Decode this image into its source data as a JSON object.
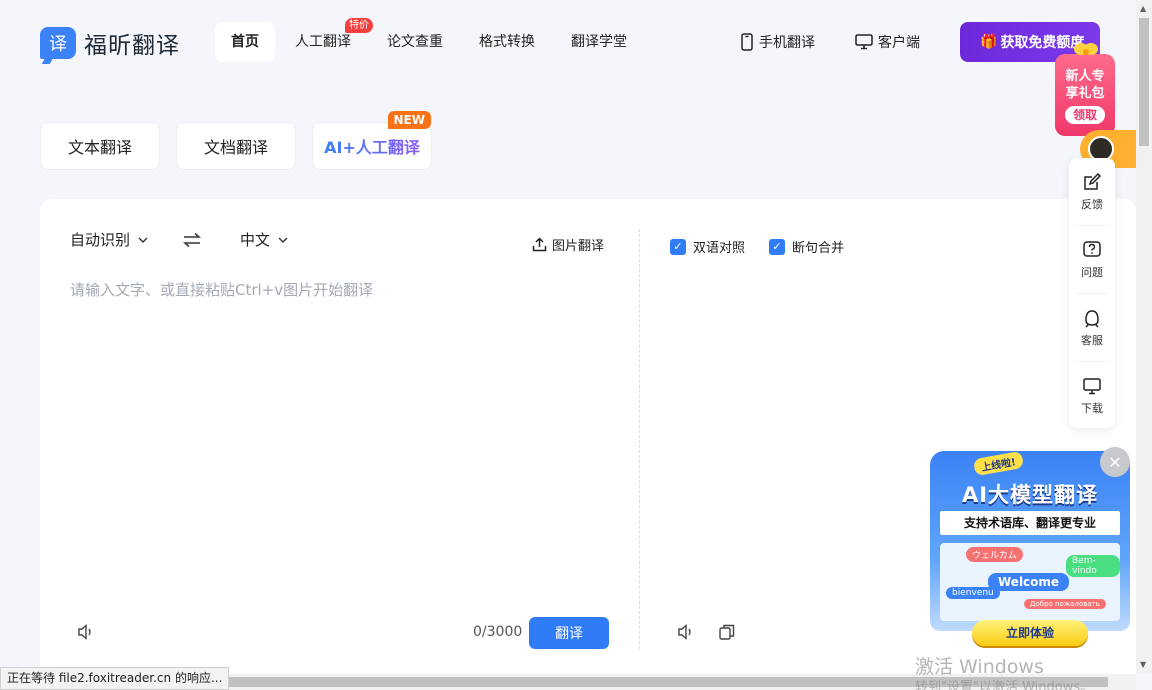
{
  "brand": {
    "logo_char": "译",
    "name": "福昕翻译"
  },
  "nav": [
    {
      "label": "首页",
      "active": true
    },
    {
      "label": "人工翻译",
      "badge": "特价"
    },
    {
      "label": "论文查重"
    },
    {
      "label": "格式转换"
    },
    {
      "label": "翻译学堂"
    }
  ],
  "top_right": {
    "mobile": "手机翻译",
    "desktop": "客户端",
    "cta": "获取免费额度"
  },
  "modes": [
    {
      "label": "文本翻译"
    },
    {
      "label": "文档翻译"
    },
    {
      "label": "AI+人工翻译",
      "badge": "NEW"
    }
  ],
  "translator": {
    "source_lang": "自动识别",
    "target_lang": "中文",
    "image_translate": "图片翻译",
    "placeholder": "请输入文字、或直接粘贴Ctrl+v图片开始翻译",
    "counter": "0/3000",
    "translate_button": "翻译",
    "option_bilingual": "双语对照",
    "option_merge": "断句合并"
  },
  "gift": {
    "line1": "新人专",
    "line2": "享礼包",
    "claim": "领取"
  },
  "sidebar": [
    {
      "label": "反馈",
      "icon": "edit-icon"
    },
    {
      "label": "问题",
      "icon": "question-icon"
    },
    {
      "label": "客服",
      "icon": "headset-icon"
    },
    {
      "label": "下载",
      "icon": "monitor-icon"
    }
  ],
  "ai_promo": {
    "tag": "上线啦!",
    "title": "AI大模型翻译",
    "subtitle": "支持术语库、翻译更专业",
    "bubbles": [
      "ウェルカム",
      "Welcome",
      "Bem-vindo",
      "bienvenu",
      "Добро пожаловать"
    ],
    "button": "立即体验"
  },
  "status": "正在等待 file2.foxitreader.cn 的响应...",
  "watermark": {
    "line1": "激活 Windows",
    "line2": "转到\"设置\"以激活 Windows。"
  }
}
